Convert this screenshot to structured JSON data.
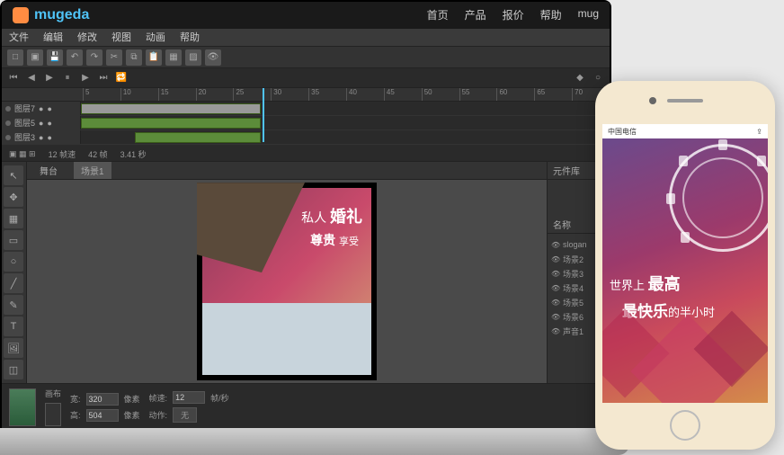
{
  "header": {
    "brand": "mugeda",
    "nav": [
      "首页",
      "产品",
      "报价",
      "帮助",
      "mug"
    ]
  },
  "menu": [
    "文件",
    "编辑",
    "修改",
    "视图",
    "动画",
    "帮助"
  ],
  "timeline": {
    "layers": [
      "图层7",
      "图层5",
      "图层3"
    ],
    "info": [
      "12 帧速",
      "42 帧",
      "3.41 秒"
    ]
  },
  "tabs": [
    "舞台",
    "场景1"
  ],
  "rightPanel": {
    "header": "元件库",
    "nameLabel": "名称",
    "items": [
      "slogan",
      "场景2",
      "场景3",
      "场景4",
      "场景5",
      "场景6",
      "声音1"
    ]
  },
  "canvas": {
    "line1_a": "私人",
    "line1_b": "婚礼",
    "line2_a": "尊贵",
    "line2_b": "享受"
  },
  "properties": {
    "thumbLabel": "画布",
    "wLabel": "宽:",
    "wVal": "320",
    "wUnit": "像素",
    "hLabel": "高:",
    "hVal": "504",
    "hUnit": "像素",
    "fpsLabel": "帧速:",
    "fpsVal": "12",
    "fpsUnit": "帧/秒",
    "actLabel": "动作:",
    "actVal": "无"
  },
  "phone": {
    "carrier": "中国电信",
    "line1_a": "世界上",
    "line1_b": "最高",
    "line2_a": "最快乐",
    "line2_b": "的半小时"
  }
}
